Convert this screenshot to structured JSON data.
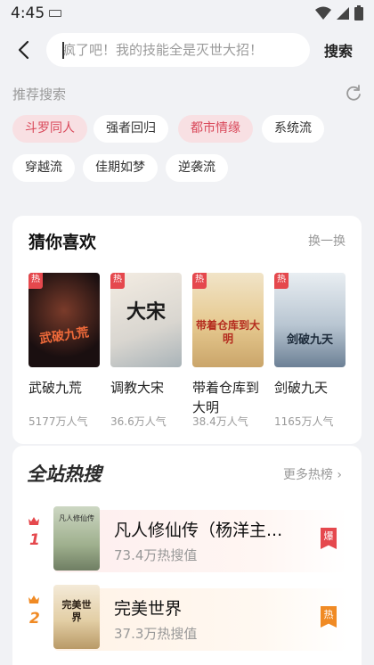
{
  "status": {
    "time": "4:45",
    "icons": [
      "keyboard-icon",
      "wifi-icon",
      "signal-icon",
      "battery-icon"
    ]
  },
  "search": {
    "placeholder": "疯了吧！我的技能全是灭世大招！",
    "button_label": "搜索",
    "back_icon": "back-arrow-icon"
  },
  "recommend": {
    "title": "推荐搜索",
    "refresh_icon": "refresh-icon",
    "chips": [
      {
        "label": "斗罗同人",
        "hot": true
      },
      {
        "label": "强者回归",
        "hot": false
      },
      {
        "label": "都市情缘",
        "hot": true
      },
      {
        "label": "系统流",
        "hot": false
      },
      {
        "label": "穿越流",
        "hot": false
      },
      {
        "label": "佳期如梦",
        "hot": false
      },
      {
        "label": "逆袭流",
        "hot": false
      }
    ]
  },
  "guess": {
    "title": "猜你喜欢",
    "swap_label": "换一换",
    "books": [
      {
        "name": "武破九荒",
        "popularity": "5177万人气",
        "badge": "热",
        "cover_text": "武破九荒"
      },
      {
        "name": "调教大宋",
        "popularity": "36.6万人气",
        "badge": "热",
        "cover_text": "大宋"
      },
      {
        "name": "带着仓库到大明",
        "popularity": "38.4万人气",
        "badge": "热",
        "cover_text": "带着仓库到大明"
      },
      {
        "name": "剑破九天",
        "popularity": "1165万人气",
        "badge": "热",
        "cover_text": "剑破九天"
      }
    ]
  },
  "hot": {
    "title": "全站热搜",
    "more_label": "更多热榜",
    "ranks": [
      {
        "rank": "1",
        "name": "凡人修仙传（杨洋主...",
        "heat": "73.4万热搜值",
        "tag": "爆",
        "cover_text": "凡人修仙传",
        "accent": "#e5484d"
      },
      {
        "rank": "2",
        "name": "完美世界",
        "heat": "37.3万热搜值",
        "tag": "热",
        "cover_text": "完美世界",
        "accent": "#f08a24"
      }
    ]
  },
  "colors": {
    "accent_red": "#e5484d",
    "accent_orange": "#f08a24",
    "chip_hot_bg": "#f8e0e3",
    "chip_hot_text": "#d9485a",
    "page_bg": "#f1f2f5"
  }
}
